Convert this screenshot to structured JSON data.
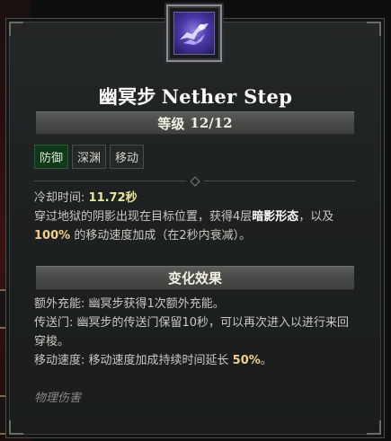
{
  "skill": {
    "icon": "nether-step-icon",
    "title_cn": "幽冥步",
    "title_en": "Nether Step"
  },
  "level": {
    "label": "等级",
    "value": "12/12"
  },
  "tags": [
    "防御",
    "深渊",
    "移动"
  ],
  "cooldown": {
    "label": "冷却时间:",
    "value": "11.72秒"
  },
  "description": {
    "part1": "穿过地狱的阴影出现在目标位置，获得4层",
    "keyword": "暗影形态",
    "part2": "，以及",
    "speed": "100%",
    "part3": "的移动速度加成（在2秒内衰减）。"
  },
  "modifiers": {
    "header": "变化效果",
    "items": [
      {
        "text": "额外充能: 幽冥步获得1次额外充能。"
      },
      {
        "text": "传送门: 幽冥步的传送门保留10秒，可以再次进入以进行来回穿梭。"
      },
      {
        "prefix": "移动速度: 移动速度加成持续时间延长 ",
        "value": "50%",
        "suffix": "。"
      }
    ]
  },
  "damage_type": "物理伤害",
  "colors": {
    "accent_value": "#f2d089",
    "cooldown_value": "#e8e69a",
    "active_tag": "#12381b"
  }
}
